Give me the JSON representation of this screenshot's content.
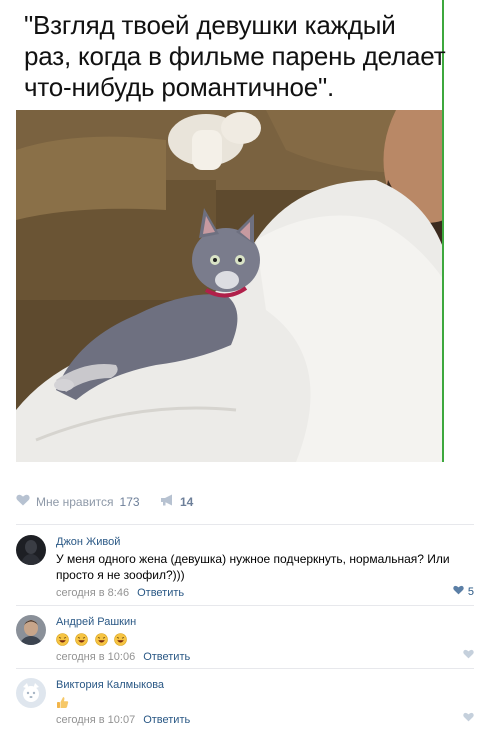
{
  "post": {
    "caption_lines": [
      "\"Взгляд твоей девушки каждый",
      "раз, когда в фильме парень делает",
      "что-нибудь романтичное\"."
    ],
    "accent_color": "#3ea83e"
  },
  "actions": {
    "like_label": "Мне нравится",
    "like_count": "173",
    "share_count": "14",
    "icons": [
      "heart-icon",
      "megaphone-icon"
    ]
  },
  "comments": [
    {
      "author": "Джон Живой",
      "text": "У меня одного жена (девушка) нужное подчеркнуть, нормальная? Или просто я не зоофил?)))",
      "time": "сегодня в 8:46",
      "reply_label": "Ответить",
      "likes": "5"
    },
    {
      "author": "Андрей Рашкин",
      "text": "",
      "emoji_count": 4,
      "emoji_icon": "laughing-emoji-icon",
      "time": "сегодня в 10:06",
      "reply_label": "Ответить",
      "likes": ""
    },
    {
      "author": "Виктория Калмыкова",
      "text": "",
      "emoji_icon": "thumbs-up-emoji-icon",
      "time": "сегодня в 10:07",
      "reply_label": "Ответить",
      "likes": ""
    }
  ],
  "colors": {
    "link": "#2a5885",
    "meta": "#939393",
    "divider": "#e7e8ec"
  }
}
